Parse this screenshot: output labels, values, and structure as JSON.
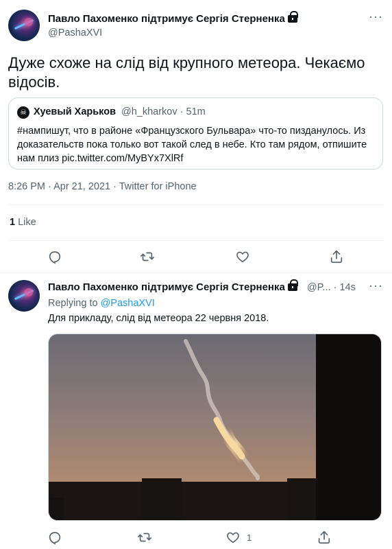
{
  "tweet": {
    "author_name": "Павло Пахоменко підтримує Сергія Стерненка",
    "author_handle": "@PashaXVI",
    "text": "Дуже схоже на слід від крупного метеора. Чекаємо відосів.",
    "timestamp": "8:26 PM · Apr 21, 2021 · Twitter for iPhone",
    "likes_count": "1",
    "likes_label": "Like",
    "more_label": "···"
  },
  "quoted": {
    "avatar_glyph": "☠",
    "author_name": "Хуевый Харьков",
    "author_handle": "@h_kharkov · 51m",
    "text": "#нампишут, что в районе «Французского Бульвара» что-то пизданулось. Из доказательств пока только вот такой след в небе. Кто там рядом, отпишите нам плиз pic.twitter.com/MyBYx7XlRf"
  },
  "reply": {
    "author_name": "Павло Пахоменко підтримує Сергія Стерненка",
    "author_handle": "@P... · 14s",
    "replying_prefix": "Replying to ",
    "replying_to": "@PashaXVI",
    "text": "Для прикладу, слід від метеора 22 червня 2018.",
    "like_count": "1",
    "more_label": "···"
  },
  "icons": {
    "reply": "reply-icon",
    "retweet": "retweet-icon",
    "like": "heart-icon",
    "share": "share-icon"
  },
  "colors": {
    "link": "#1d9bf0",
    "secondary_text": "#536471",
    "border": "#cfd9de"
  }
}
